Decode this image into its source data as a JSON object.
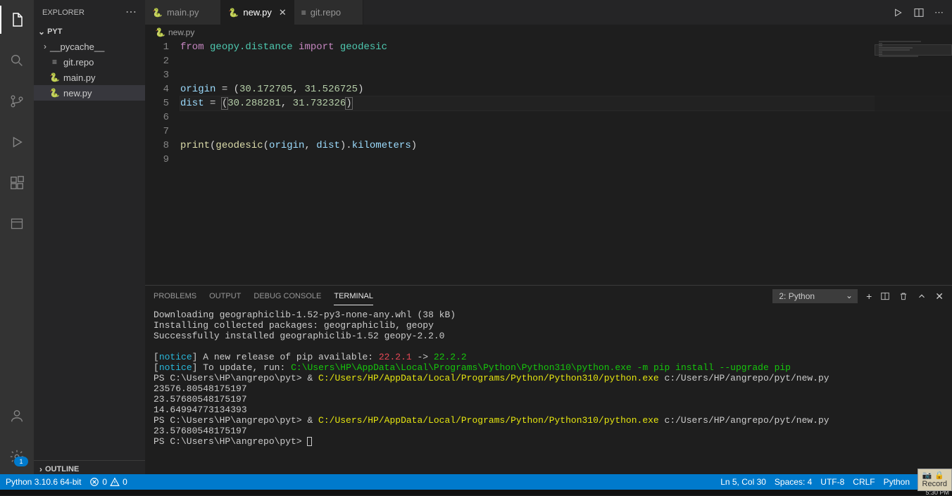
{
  "sidebar": {
    "title": "EXPLORER",
    "folder": "PYT",
    "items": [
      {
        "label": "__pycache__",
        "type": "folder"
      },
      {
        "label": "git.repo",
        "type": "file"
      },
      {
        "label": "main.py",
        "type": "py"
      },
      {
        "label": "new.py",
        "type": "py",
        "selected": true
      }
    ],
    "outline": "OUTLINE"
  },
  "tabs": [
    {
      "label": "main.py",
      "type": "py",
      "active": false
    },
    {
      "label": "new.py",
      "type": "py",
      "active": true
    },
    {
      "label": "git.repo",
      "type": "file",
      "active": false
    }
  ],
  "breadcrumb": {
    "file": "new.py"
  },
  "code": {
    "lines": [
      {
        "n": 1,
        "seg": [
          [
            "from",
            "k-mag"
          ],
          [
            " ",
            "k-op"
          ],
          [
            "geopy.distance",
            "k-mod"
          ],
          [
            " ",
            "k-op"
          ],
          [
            "import",
            "k-mag"
          ],
          [
            " ",
            "k-op"
          ],
          [
            "geodesic",
            "k-mod"
          ]
        ]
      },
      {
        "n": 2,
        "seg": []
      },
      {
        "n": 3,
        "seg": []
      },
      {
        "n": 4,
        "seg": [
          [
            "origin",
            "k-var"
          ],
          [
            " = (",
            "k-op"
          ],
          [
            "30.172705",
            "k-num"
          ],
          [
            ", ",
            "k-op"
          ],
          [
            "31.526725",
            "k-num"
          ],
          [
            ")",
            "k-op"
          ]
        ]
      },
      {
        "n": 5,
        "current": true,
        "seg": [
          [
            "dist",
            "k-var"
          ],
          [
            " = ",
            "k-op"
          ],
          [
            "(",
            "k-op bracket-box"
          ],
          [
            "30.288281",
            "k-num"
          ],
          [
            ", ",
            "k-op"
          ],
          [
            "31.732326",
            "k-num"
          ],
          [
            ")",
            "k-op bracket-box"
          ]
        ]
      },
      {
        "n": 6,
        "seg": []
      },
      {
        "n": 7,
        "seg": []
      },
      {
        "n": 8,
        "seg": [
          [
            "print",
            "k-fun"
          ],
          [
            "(",
            "k-op"
          ],
          [
            "geodesic",
            "k-fun"
          ],
          [
            "(",
            "k-op"
          ],
          [
            "origin",
            "k-var"
          ],
          [
            ", ",
            "k-op"
          ],
          [
            "dist",
            "k-var"
          ],
          [
            ").",
            "k-op"
          ],
          [
            "kilometers",
            "k-var"
          ],
          [
            ")",
            "k-op"
          ]
        ]
      },
      {
        "n": 9,
        "seg": []
      }
    ]
  },
  "panel": {
    "tabs": [
      "PROBLEMS",
      "OUTPUT",
      "DEBUG CONSOLE",
      "TERMINAL"
    ],
    "activeTab": "TERMINAL",
    "shell": "2: Python",
    "lines": [
      [
        [
          "  Downloading geographiclib-1.52-py3-none-any.whl (38 kB)",
          "t-white"
        ]
      ],
      [
        [
          "Installing collected packages: geographiclib, geopy",
          "t-white"
        ]
      ],
      [
        [
          "Successfully installed geographiclib-1.52 geopy-2.2.0",
          "t-white"
        ]
      ],
      [],
      [
        [
          "[",
          "t-white"
        ],
        [
          "notice",
          "t-cyan"
        ],
        [
          "] A new release of pip available: ",
          "t-white"
        ],
        [
          "22.2.1",
          "t-red"
        ],
        [
          " -> ",
          "t-white"
        ],
        [
          "22.2.2",
          "t-green"
        ]
      ],
      [
        [
          "[",
          "t-white"
        ],
        [
          "notice",
          "t-cyan"
        ],
        [
          "] To update, run: ",
          "t-white"
        ],
        [
          "C:\\Users\\HP\\AppData\\Local\\Programs\\Python\\Python310\\python.exe -m pip install --upgrade pip",
          "t-green"
        ]
      ],
      [
        [
          "PS C:\\Users\\HP\\angrepo\\pyt> ",
          "t-white"
        ],
        [
          "& ",
          "t-white"
        ],
        [
          "C:/Users/HP/AppData/Local/Programs/Python/Python310/python.exe ",
          "t-yellow"
        ],
        [
          "c:/Users/HP/angrepo/pyt/new.py",
          "t-white"
        ]
      ],
      [
        [
          "23576.80548175197",
          "t-white"
        ]
      ],
      [
        [
          "23.57680548175197",
          "t-white"
        ]
      ],
      [
        [
          "14.64994773134393",
          "t-white"
        ]
      ],
      [
        [
          "PS C:\\Users\\HP\\angrepo\\pyt> ",
          "t-white"
        ],
        [
          "& ",
          "t-white"
        ],
        [
          "C:/Users/HP/AppData/Local/Programs/Python/Python310/python.exe ",
          "t-yellow"
        ],
        [
          "c:/Users/HP/angrepo/pyt/new.py",
          "t-white"
        ]
      ],
      [
        [
          "23.57680548175197",
          "t-white"
        ]
      ],
      [
        [
          "PS C:\\Users\\HP\\angrepo\\pyt> ",
          "t-white"
        ]
      ]
    ]
  },
  "statusbar": {
    "python": "Python 3.10.6 64-bit",
    "errors": "0",
    "warnings": "0",
    "position": "Ln 5, Col 30",
    "spaces": "Spaces: 4",
    "encoding": "UTF-8",
    "eol": "CRLF",
    "lang": "Python"
  },
  "record": "Record",
  "taskbar": {
    "time": "5:30 PM"
  }
}
